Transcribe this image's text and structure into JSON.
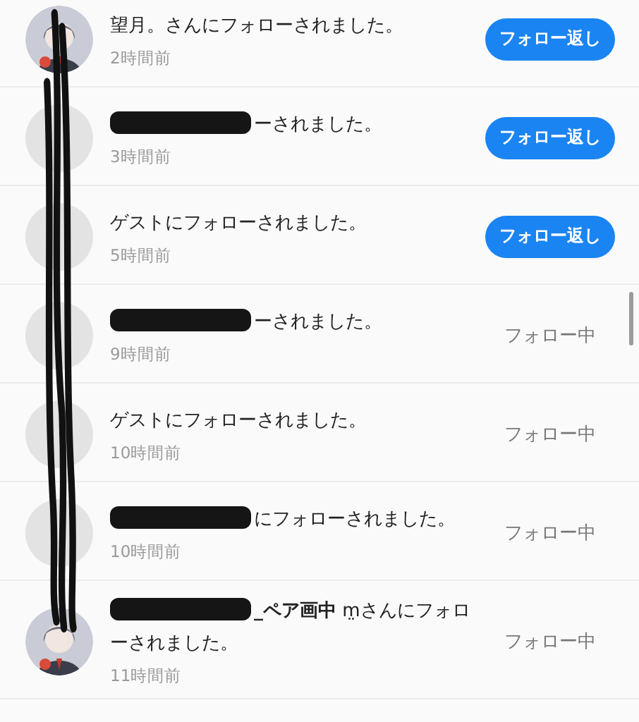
{
  "notifications": [
    {
      "message": "望月。さんにフォローされました。",
      "redacted": false,
      "time": "2時間前",
      "button": {
        "label": "フォロー返し",
        "kind": "follow_back"
      }
    },
    {
      "avatar": {
        "kind": "placeholder"
      },
      "message": "ーされました。",
      "redacted": true,
      "time": "3時間前",
      "button": {
        "label": "フォロー返し",
        "kind": "follow_back"
      }
    },
    {
      "avatar": {
        "kind": "placeholder"
      },
      "message": "ゲストにフォローされました。",
      "redacted": false,
      "time": "5時間前",
      "button": {
        "label": "フォロー返し",
        "kind": "follow_back"
      }
    },
    {
      "avatar": {
        "kind": "placeholder"
      },
      "message": "ーされました。",
      "redacted": true,
      "time": "9時間前",
      "button": {
        "label": "フォロー中",
        "kind": "following"
      }
    },
    {
      "avatar": {
        "kind": "placeholder"
      },
      "message": "ゲストにフォローされました。",
      "redacted": false,
      "time": "10時間前",
      "button": {
        "label": "フォロー中",
        "kind": "following"
      }
    },
    {
      "avatar": {
        "kind": "placeholder"
      },
      "message": "にフォローされました。",
      "redacted": true,
      "time": "10時間前",
      "button": {
        "label": "フォロー中",
        "kind": "following"
      }
    },
    {
      "message": "**_ペア画中** m̤さんにフォローされました。",
      "redacted": true,
      "time": "11時間前",
      "button": {
        "label": "フォロー中",
        "kind": "following"
      }
    }
  ]
}
